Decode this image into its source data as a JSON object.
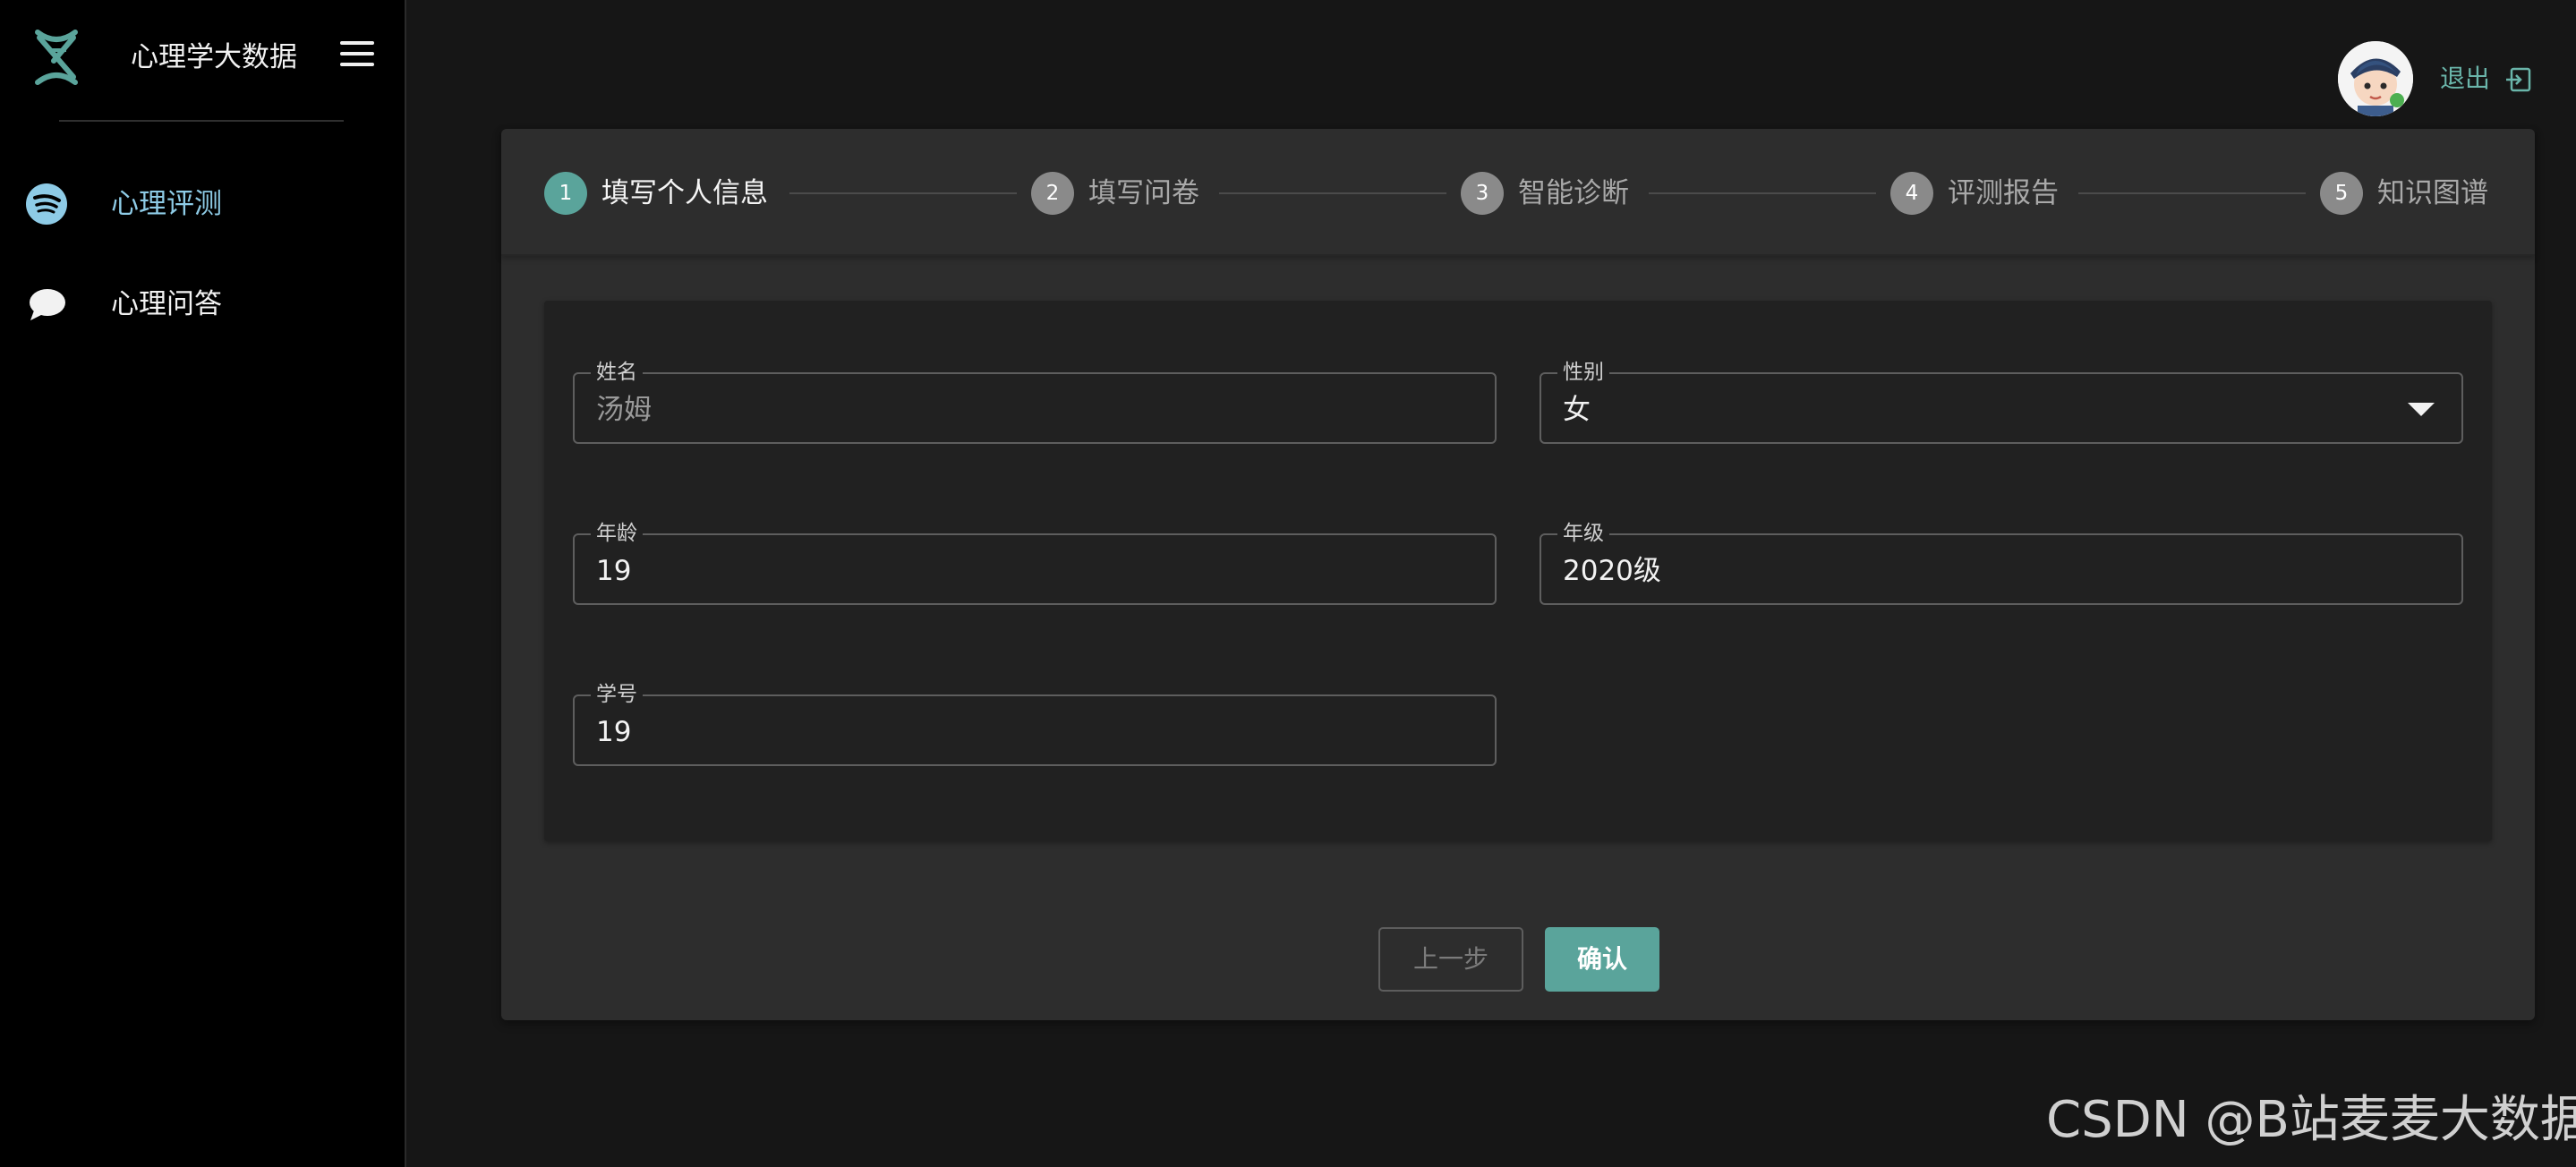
{
  "sidebar": {
    "title": "心理学大数据",
    "items": [
      {
        "label": "心理评测",
        "icon": "spotify-icon",
        "active": true
      },
      {
        "label": "心理问答",
        "icon": "chat-bubble-icon",
        "active": false
      }
    ]
  },
  "header": {
    "logout_label": "退出"
  },
  "stepper": {
    "steps": [
      {
        "num": "1",
        "label": "填写个人信息"
      },
      {
        "num": "2",
        "label": "填写问卷"
      },
      {
        "num": "3",
        "label": "智能诊断"
      },
      {
        "num": "4",
        "label": "评测报告"
      },
      {
        "num": "5",
        "label": "知识图谱"
      }
    ],
    "active_step": 1
  },
  "form": {
    "name": {
      "label": "姓名",
      "value": "汤姆"
    },
    "gender": {
      "label": "性别",
      "value": "女"
    },
    "age": {
      "label": "年龄",
      "value": "19"
    },
    "grade": {
      "label": "年级",
      "value": "2020级"
    },
    "student_id": {
      "label": "学号",
      "value": "19"
    }
  },
  "actions": {
    "prev_label": "上一步",
    "confirm_label": "确认"
  },
  "watermark": "CSDN @B站麦麦大数据",
  "colors": {
    "accent": "#5aa49b",
    "active_nav": "#8ecbe6",
    "logout": "#6ab5aa"
  }
}
